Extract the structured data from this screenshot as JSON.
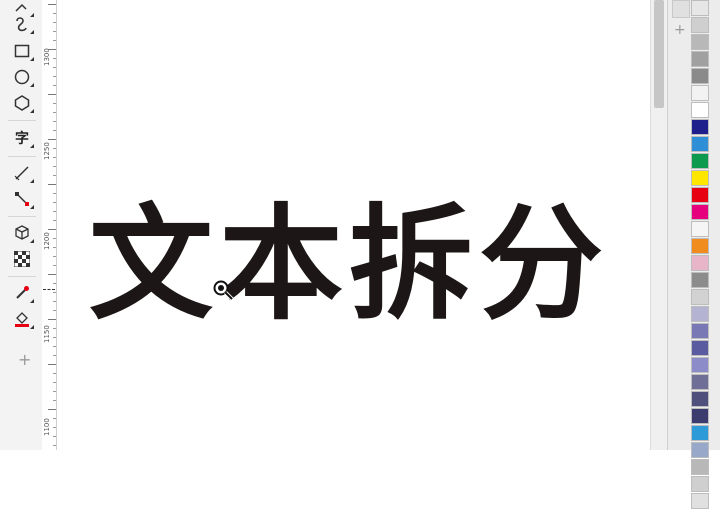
{
  "toolbox": {
    "tools": [
      "freehand-icon",
      "artistic-media-icon",
      "rectangle-icon",
      "ellipse-icon",
      "polygon-icon",
      "text-tool-icon",
      "dimension-icon",
      "connector-icon",
      "extrude-icon",
      "transparency-icon",
      "eyedropper-icon",
      "fill-icon"
    ],
    "text_tool_glyph": "字",
    "add_tool": "+"
  },
  "ruler": {
    "labels": [
      "1300",
      "1250",
      "1200",
      "1150",
      "1100"
    ]
  },
  "canvas": {
    "headline": "文本拆分",
    "headline_color": "#1d1616"
  },
  "palette": {
    "add_label": "+",
    "colors": [
      "#e6e6e6",
      "#cfcfcf",
      "#b8b8b8",
      "#a0a0a0",
      "#8a8a8a",
      "#f2f2f2",
      "#ffffff",
      "#1e1e8c",
      "#2e8fd6",
      "#0c9a4e",
      "#ffe600",
      "#e60012",
      "#e6007e",
      "#f5f5f5",
      "#f08c1e",
      "#e8b4c8",
      "#8c8c8c",
      "#d2d2d2",
      "#b4b4d2",
      "#7878b4",
      "#5a5aa0",
      "#8c8cc8",
      "#6e6e96",
      "#50507c",
      "#3c3c6e",
      "#2e9ad8",
      "#98a8c8",
      "#b8b8b8",
      "#cfcfcf",
      "#e0e0e0"
    ]
  }
}
